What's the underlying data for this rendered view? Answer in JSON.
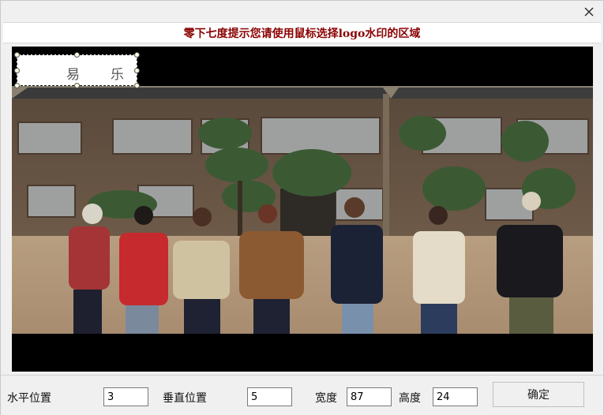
{
  "dialog": {
    "close_icon": "close-icon",
    "title": "零下七度提示您请使用鼠标选择logo水印的区域"
  },
  "preview": {
    "selection_box": {
      "text_left": "易",
      "text_right": "乐"
    }
  },
  "controls": {
    "horizontal_label": "水平位置",
    "horizontal_value": "3",
    "vertical_label": "垂直位置",
    "vertical_value": "5",
    "width_label": "宽度",
    "width_value": "87",
    "height_label": "高度",
    "height_value": "24",
    "ok_label": "确定"
  },
  "colors": {
    "title_text": "#8b0000",
    "preview_bg": "#000000"
  }
}
